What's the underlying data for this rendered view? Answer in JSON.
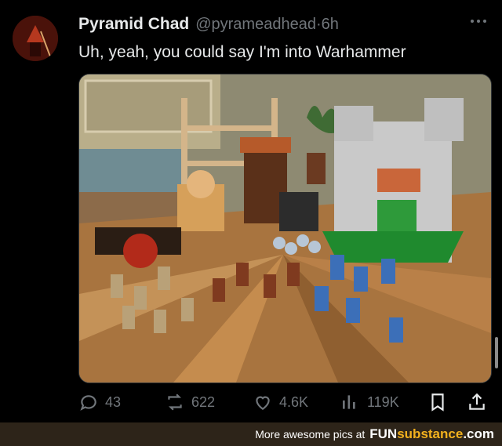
{
  "tweet": {
    "display_name": "Pyramid Chad",
    "handle": "@pyrameadhead",
    "separator": "·",
    "time": "6h",
    "text": "Uh, yeah, you could say I'm into Warhammer",
    "more_icon": "more-horizontal-icon"
  },
  "metrics": {
    "replies": "43",
    "reposts": "622",
    "likes": "4.6K",
    "views": "119K"
  },
  "icons": {
    "reply": "reply-icon",
    "repost": "repost-icon",
    "like": "heart-icon",
    "views": "views-icon",
    "bookmark": "bookmark-icon",
    "share": "share-icon"
  },
  "footer": {
    "text": "More awesome pics at",
    "brand_fun": "FUN",
    "brand_sub": "substance",
    "brand_com": ".com"
  },
  "colors": {
    "background": "#000000",
    "text": "#e7e9ea",
    "muted": "#71767b",
    "footer_bg": "#2d2419",
    "brand_accent": "#f2b11e"
  }
}
